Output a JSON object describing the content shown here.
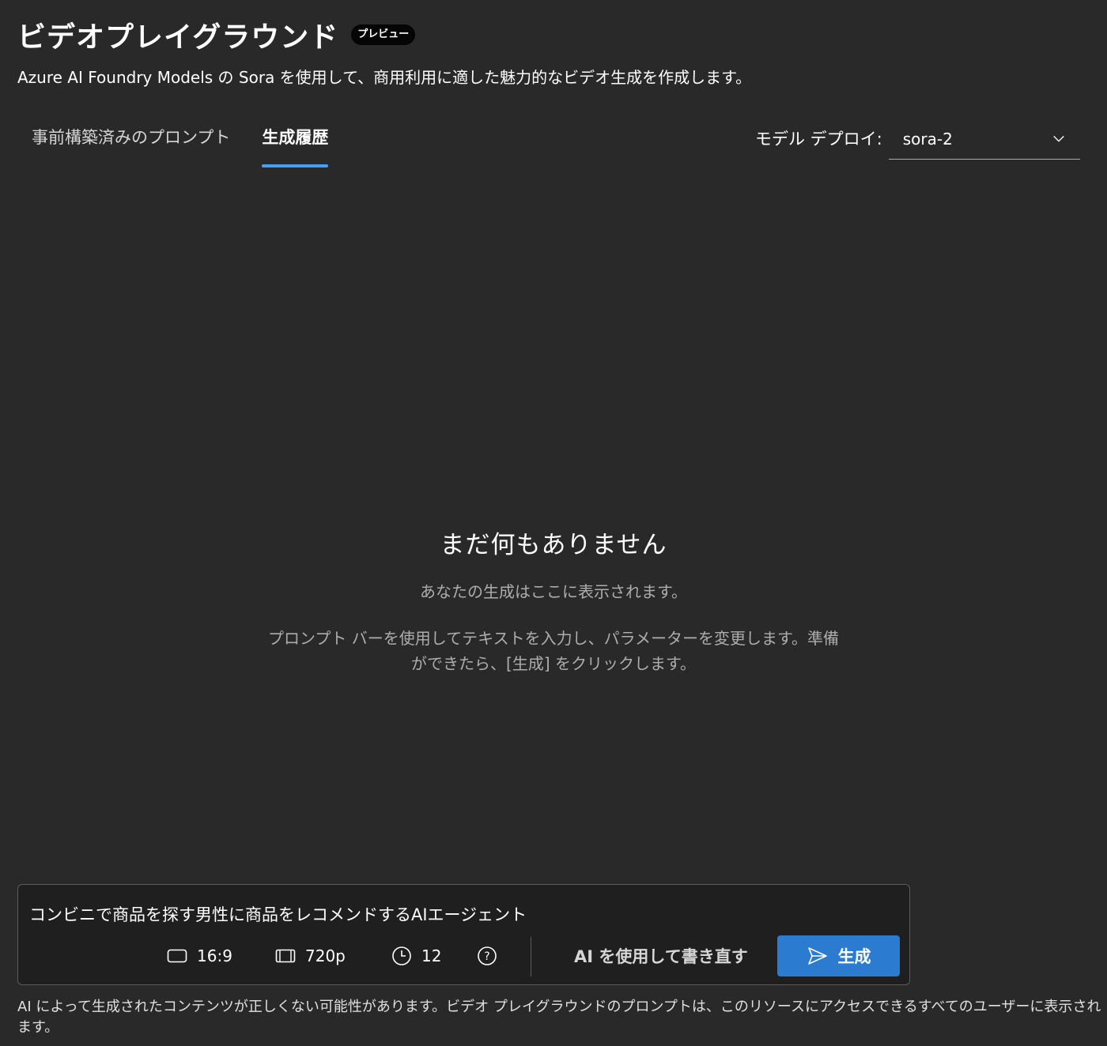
{
  "header": {
    "title": "ビデオプレイグラウンド",
    "badge": "プレビュー",
    "subtitle": "Azure AI Foundry Models の Sora を使用して、商用利用に適した魅力的なビデオ生成を作成します。"
  },
  "tabs": [
    {
      "label": "事前構築済みのプロンプト",
      "active": false
    },
    {
      "label": "生成履歴",
      "active": true
    }
  ],
  "model": {
    "label": "モデル デプロイ:",
    "value": "sora-2",
    "icon": "chevron-down-icon"
  },
  "empty_state": {
    "title": "まだ何もありません",
    "subtitle": "あなたの生成はここに表示されます。",
    "help": "プロンプト バーを使用してテキストを入力し、パラメーターを変更します。準備ができたら、[生成] をクリックします。"
  },
  "prompt": {
    "text": "コンビニで商品を探す男性に商品をレコメンドするAIエージェント",
    "aspect_ratio": "16:9",
    "resolution": "720p",
    "duration": "12",
    "rewrite_label": "AI を使用して書き直す",
    "generate_label": "生成"
  },
  "footer": {
    "disclaimer": "AI によって生成されたコンテンツが正しくない可能性があります。ビデオ プレイグラウンドのプロンプトは、このリソースにアクセスできるすべてのユーザーに表示されます。"
  },
  "colors": {
    "background": "#292929",
    "accent": "#479ef5",
    "primary_button": "#2b7bd1"
  }
}
